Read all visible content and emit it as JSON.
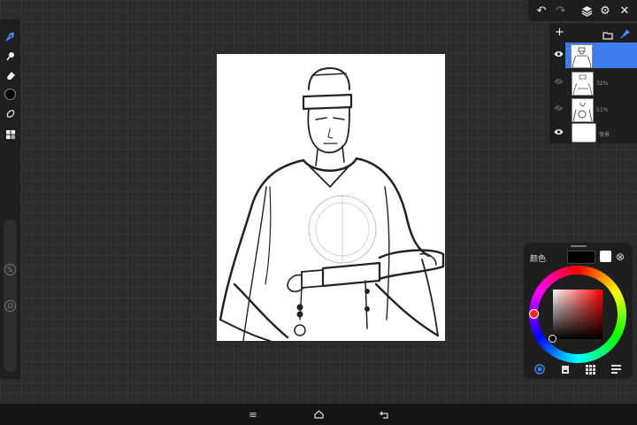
{
  "toolbar_left": {
    "tools": [
      {
        "name": "brush",
        "icon": "brush-icon",
        "active": true
      },
      {
        "name": "smudge",
        "icon": "smudge-icon"
      },
      {
        "name": "eraser",
        "icon": "eraser-icon"
      },
      {
        "name": "color",
        "icon": "color-swatch",
        "color": "#000000"
      },
      {
        "name": "lasso",
        "icon": "lasso-icon"
      },
      {
        "name": "transform",
        "icon": "grid-icon"
      }
    ],
    "size_label": "S",
    "opacity_label": "O"
  },
  "toolbar_top": {
    "undo_icon": "↶",
    "redo_icon": "↷",
    "layers_icon": "◈",
    "settings_icon": "⚙",
    "close_icon": "✕"
  },
  "layers": {
    "add_icon": "+",
    "folder_icon": "▭",
    "pin_icon": "📌",
    "items": [
      {
        "visible": true,
        "selected": true,
        "opacity": ""
      },
      {
        "visible": false,
        "selected": false,
        "opacity": "32%"
      },
      {
        "visible": false,
        "selected": false,
        "opacity": "51%"
      },
      {
        "visible": true,
        "selected": false,
        "opacity": "",
        "name": "背景"
      }
    ]
  },
  "color_panel": {
    "label": "颜色",
    "current_color": "#000000",
    "secondary_color": "#ffffff",
    "close_icon": "⊗",
    "tabs": [
      "wheel",
      "palette",
      "grid",
      "list"
    ]
  },
  "nav": {
    "menu_icon": "≡",
    "home_icon": "⌂",
    "back_icon": "⤶"
  },
  "colors": {
    "accent": "#3d7cf0",
    "panel": "#1e1e1e",
    "canvas_bg": "#2b2b2b"
  }
}
